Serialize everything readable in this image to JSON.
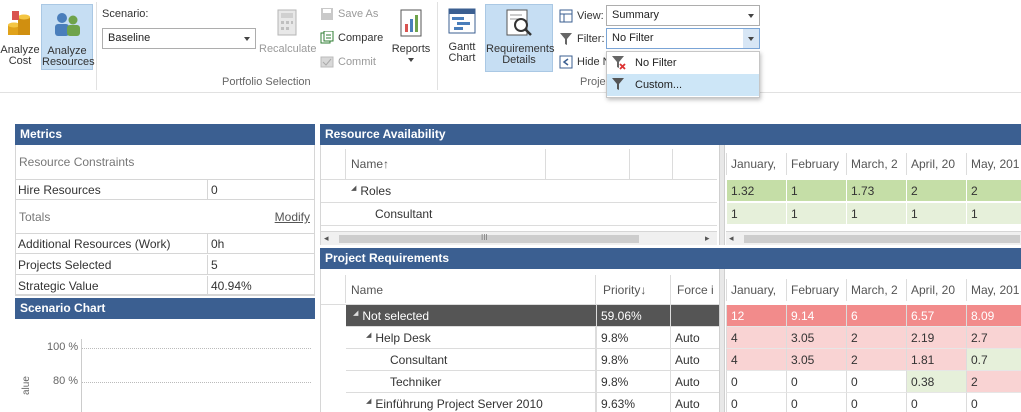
{
  "ribbon": {
    "analyze_cost": "Analyze\nCost",
    "analyze_cost_l1": "Analyze",
    "analyze_cost_l2": "Cost",
    "analyze_resources_l1": "Analyze",
    "analyze_resources_l2": "Resources",
    "scenario_label": "Scenario:",
    "scenario_value": "Baseline",
    "recalculate": "Recalculate",
    "save_as": "Save As",
    "compare": "Compare",
    "commit": "Commit",
    "reports": "Reports",
    "portfolio_selection": "Portfolio Selection",
    "gantt_l1": "Gantt",
    "gantt_l2": "Chart",
    "req_l1": "Requirements",
    "req_l2": "Details",
    "view_label": "View:",
    "view_value": "Summary",
    "filter_label": "Filter:",
    "filter_value": "No Filter",
    "hide_label": "Hide N",
    "group_partial": "Proje"
  },
  "filter_dropdown": {
    "options": [
      "No Filter",
      "Custom..."
    ],
    "highlighted": "Custom..."
  },
  "metrics": {
    "title": "Metrics",
    "resource_constraints": "Resource Constraints",
    "hire_resources_label": "Hire Resources",
    "hire_resources_value": "0",
    "totals": "Totals",
    "modify": "Modify",
    "rows": [
      {
        "label": "Additional Resources (Work)",
        "value": "0h"
      },
      {
        "label": "Projects Selected",
        "value": "5"
      },
      {
        "label": "Strategic Value",
        "value": "40.94%"
      }
    ]
  },
  "scenario_chart": {
    "title": "Scenario Chart",
    "ticks": [
      "100 %",
      "80 %"
    ],
    "ylabel_partial": "alue"
  },
  "resource_availability": {
    "title": "Resource Availability",
    "name_header": "Name",
    "months": [
      "January,",
      "February",
      "March, 2",
      "April, 20",
      "May, 201"
    ],
    "rows": [
      {
        "name": "Roles",
        "expand": true,
        "values": [
          "1.32",
          "1",
          "1.73",
          "2",
          "2"
        ]
      },
      {
        "name": "Consultant",
        "expand": false,
        "values": [
          "1",
          "1",
          "1",
          "1",
          "1"
        ]
      }
    ]
  },
  "project_requirements": {
    "title": "Project Requirements",
    "headers": {
      "name": "Name",
      "priority": "Priority",
      "force": "Force i"
    },
    "months": [
      "January,",
      "February",
      "March, 2",
      "April, 20",
      "May, 201"
    ],
    "rows": [
      {
        "name": "Not selected",
        "level": 0,
        "expand": true,
        "priority": "59.06%",
        "force": "",
        "values": [
          "12",
          "9.14",
          "6",
          "6.57",
          "8.09"
        ]
      },
      {
        "name": "Help Desk",
        "level": 1,
        "expand": true,
        "priority": "9.8%",
        "force": "Auto",
        "values": [
          "4",
          "3.05",
          "2",
          "2.19",
          "2.7"
        ]
      },
      {
        "name": "Consultant",
        "level": 2,
        "expand": false,
        "priority": "9.8%",
        "force": "Auto",
        "values": [
          "4",
          "3.05",
          "2",
          "1.81",
          "0.7"
        ]
      },
      {
        "name": "Techniker",
        "level": 2,
        "expand": false,
        "priority": "9.8%",
        "force": "Auto",
        "values": [
          "0",
          "0",
          "0",
          "0.38",
          "2"
        ]
      },
      {
        "name": "Einführung Project Server 2010",
        "level": 1,
        "expand": true,
        "priority": "9.63%",
        "force": "Auto",
        "values": [
          "0",
          "0",
          "0",
          "0",
          "0"
        ]
      }
    ]
  },
  "colors": {
    "header_blue": "#3b5f91",
    "selected_row": "#555555",
    "red_strong": "#f28b8b",
    "red_light": "#f9d3d3",
    "green_strong": "#c5dea7",
    "green_light": "#e6f0da"
  }
}
